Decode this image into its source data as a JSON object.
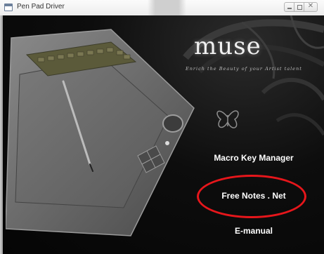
{
  "window": {
    "title": "Pen Pad Driver"
  },
  "branding": {
    "logo": "muse",
    "tagline": "Enrich the Beauty of your Artist talent"
  },
  "menu": {
    "items": [
      {
        "label": "Macro Key Manager"
      },
      {
        "label": "Free Notes . Net"
      },
      {
        "label": "E-manual"
      }
    ]
  },
  "annotation": {
    "color": "#e6161b"
  },
  "icons": {
    "app": "window-app-icon",
    "minimize": "minimize-icon",
    "maximize": "maximize-icon",
    "close": "close-icon"
  }
}
